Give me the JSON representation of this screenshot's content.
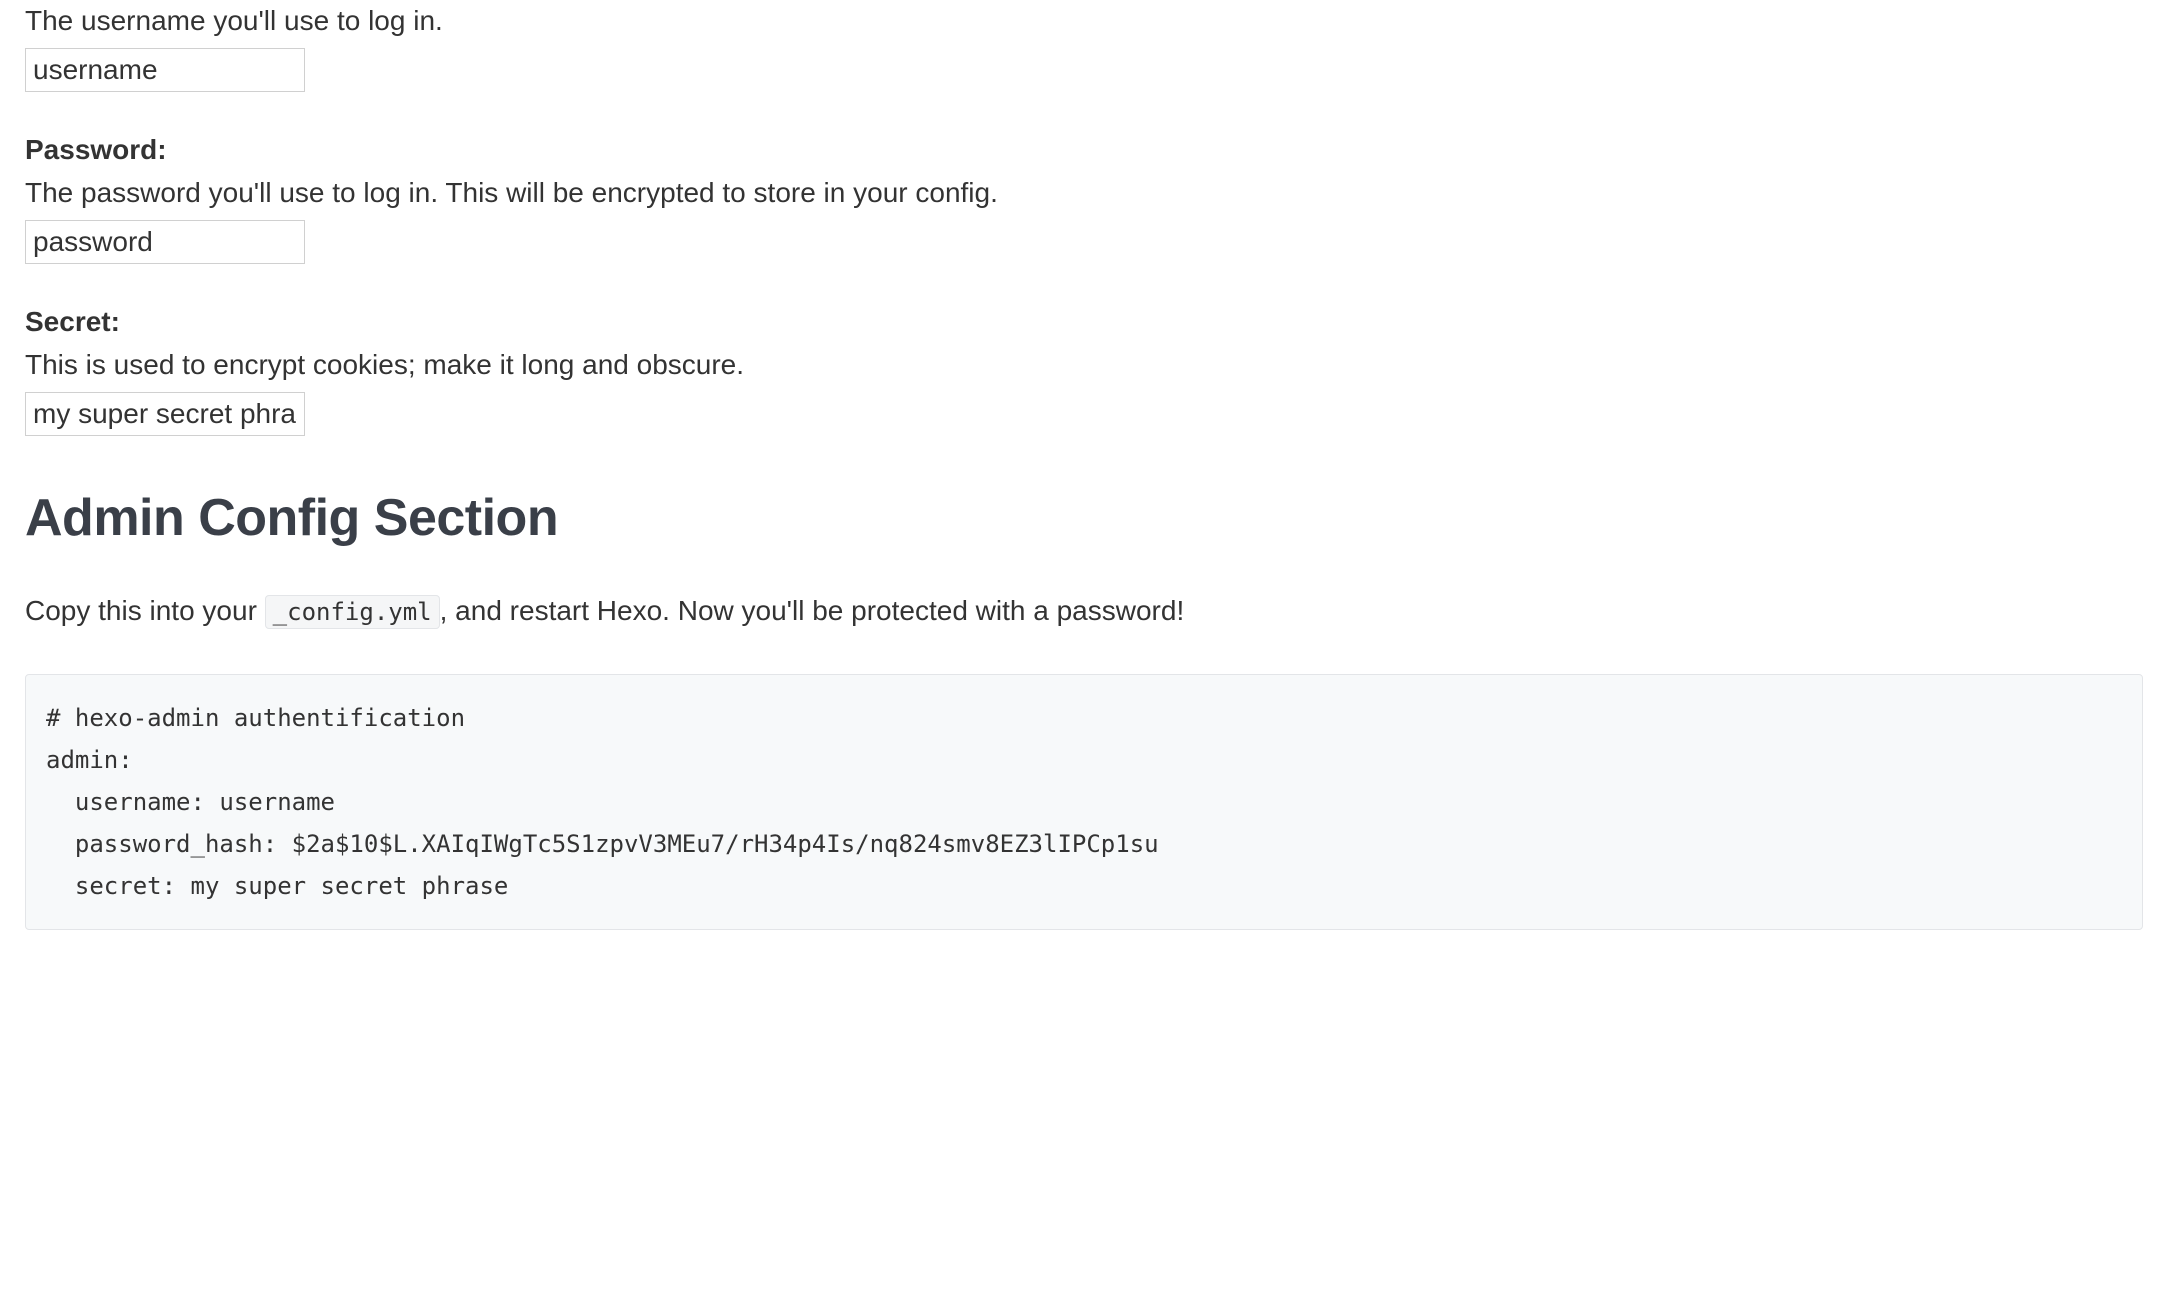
{
  "username": {
    "description": "The username you'll use to log in.",
    "value": "username"
  },
  "password": {
    "label": "Password:",
    "description": "The password you'll use to log in. This will be encrypted to store in your config.",
    "value": "password"
  },
  "secret": {
    "label": "Secret:",
    "description": "This is used to encrypt cookies; make it long and obscure.",
    "value": "my super secret phrase"
  },
  "config_section": {
    "heading": "Admin Config Section",
    "instruction_prefix": "Copy this into your ",
    "config_filename": "_config.yml",
    "instruction_suffix": ", and restart Hexo. Now you'll be protected with a password!",
    "code": "# hexo-admin authentification\nadmin:\n  username: username\n  password_hash: $2a$10$L.XAIqIWgTc5S1zpvV3MEu7/rH34p4Is/nq824smv8EZ3lIPCp1su\n  secret: my super secret phrase"
  }
}
